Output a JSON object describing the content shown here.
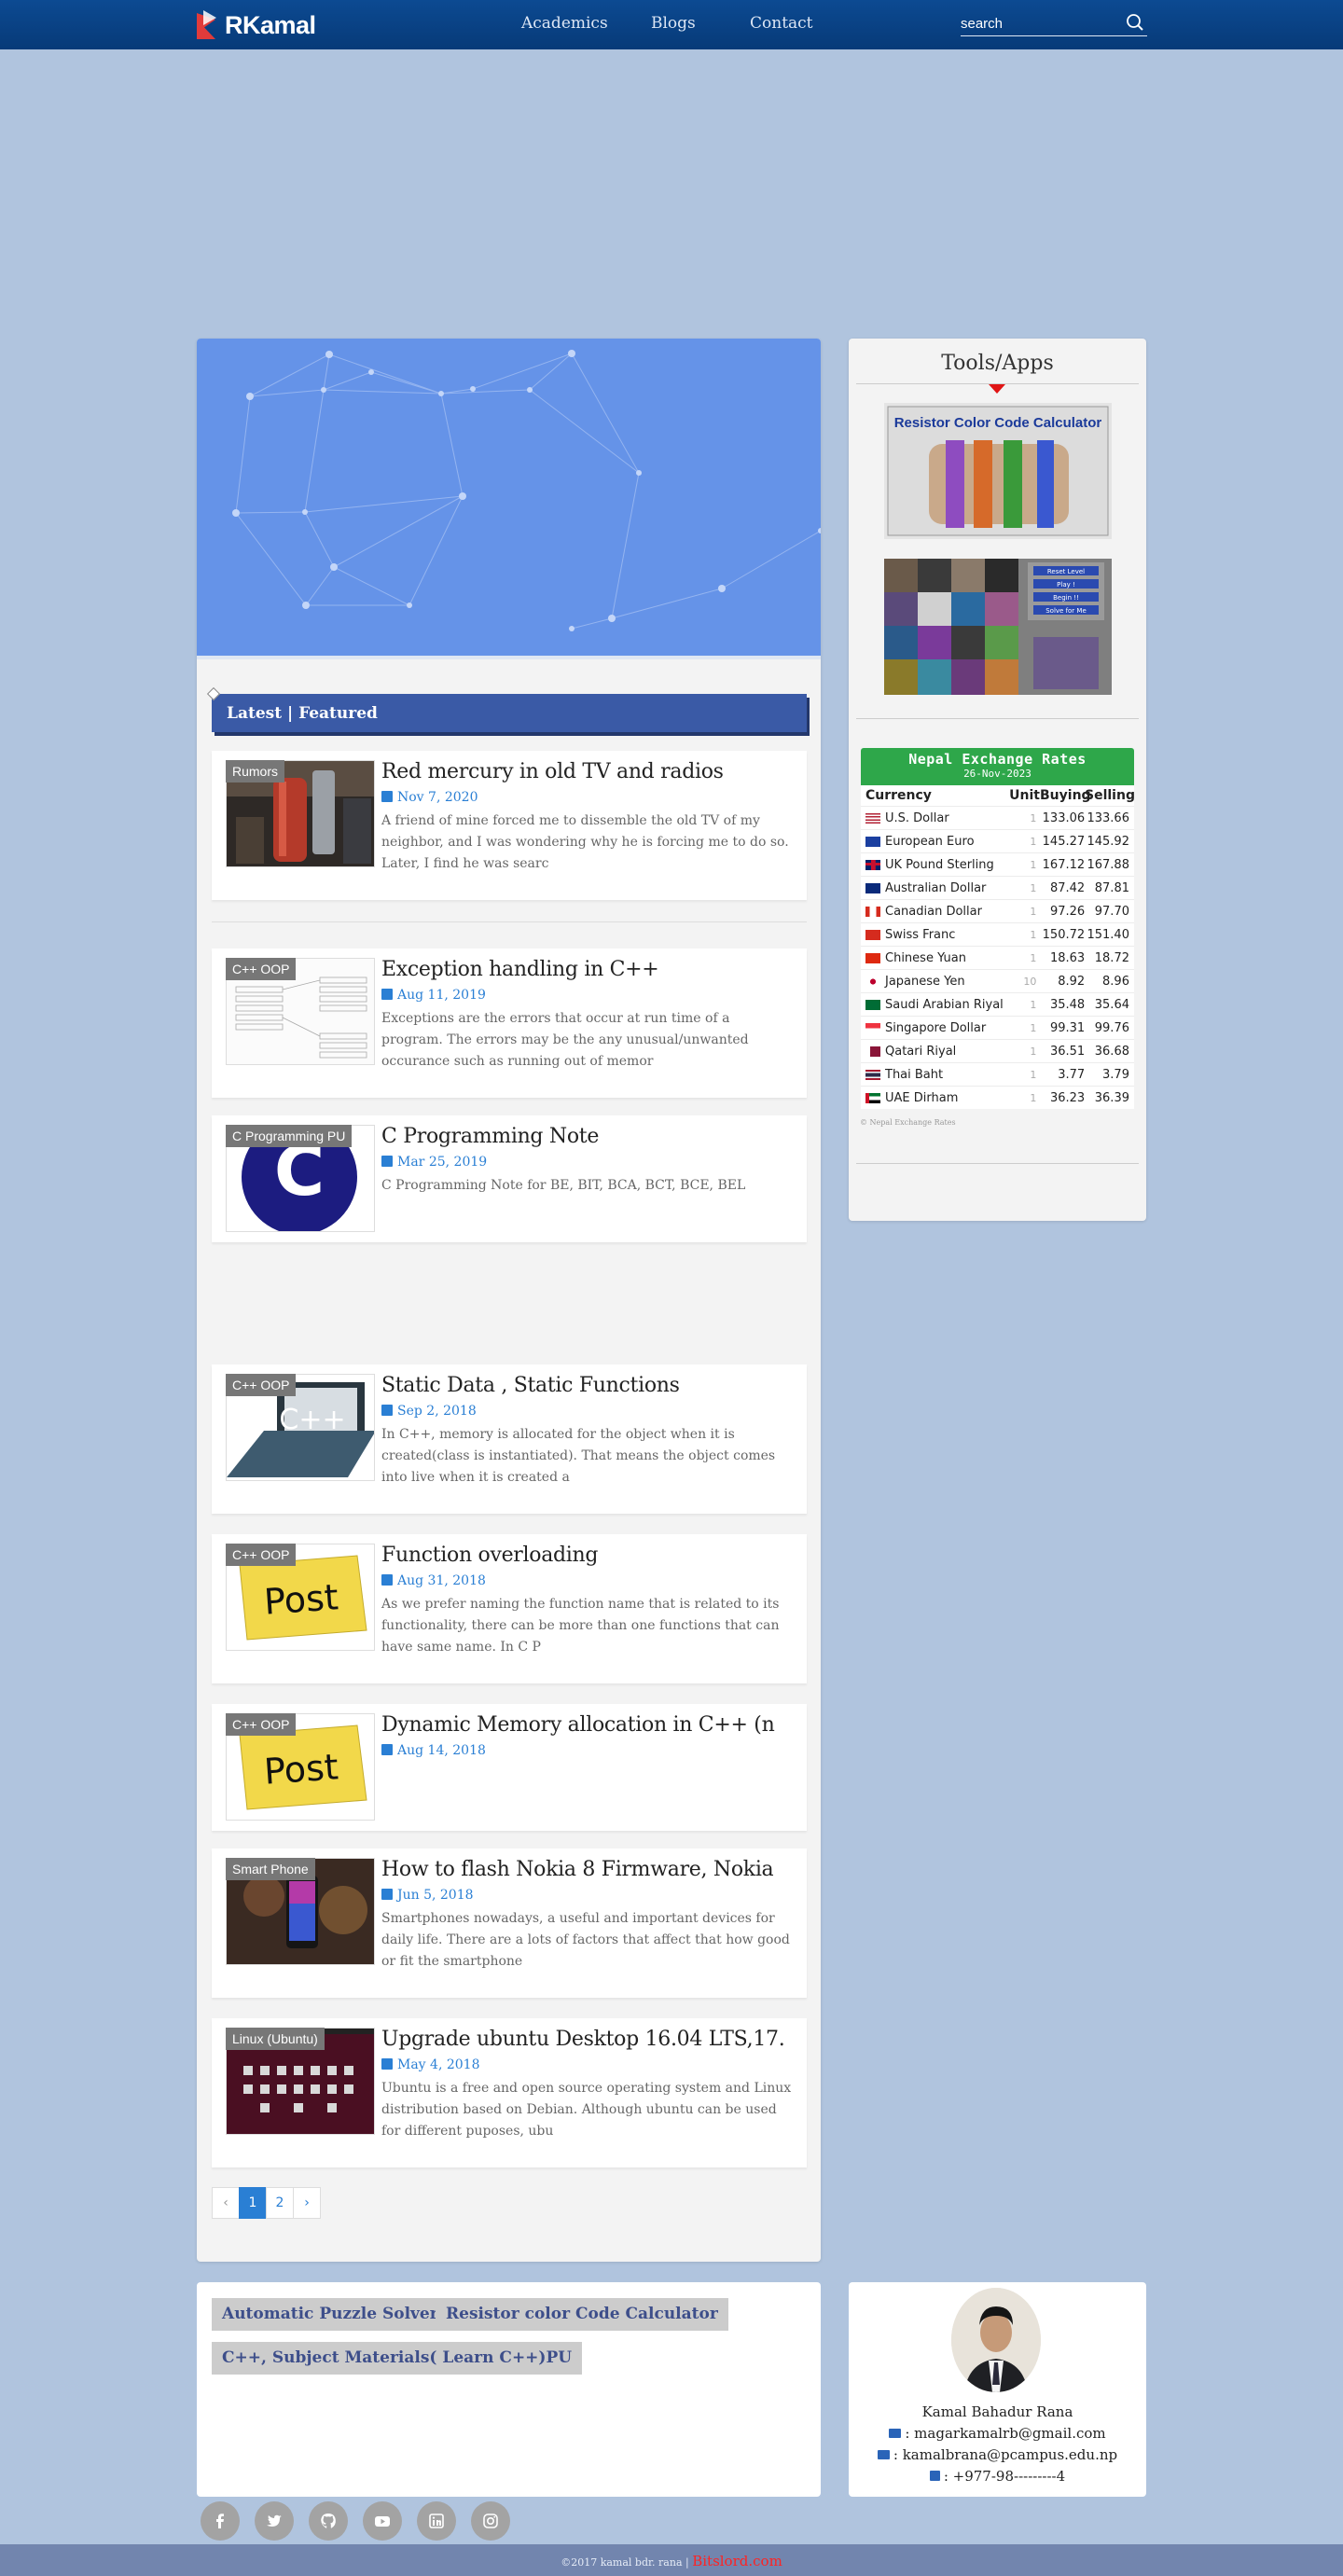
{
  "nav": {
    "brand": "RKamal",
    "links": [
      "Academics",
      "Blogs",
      "Contact"
    ],
    "search_placeholder": "search"
  },
  "featured": {
    "heading": "Latest | Featured",
    "posts": [
      {
        "badge": "Rumors",
        "title": "Red mercury in old TV and radios",
        "date": "Nov 7, 2020",
        "excerpt": "A friend of mine forced me to dissemble the old TV of my neighbor, and I was wondering why he is forcing me to do so. Later, I find he was searc"
      },
      {
        "badge": "C++ OOP",
        "title": "Exception handling in C++",
        "date": "Aug 11, 2019",
        "excerpt": "Exceptions are the errors that occur at run time of a program. The errors may be the any unusual/unwanted occurance such as running out of memor"
      },
      {
        "badge": "C Programming PU",
        "title": "C Programming Note",
        "date": "Mar 25, 2019",
        "excerpt": "C Programming Note for BE, BIT, BCA, BCT, BCE, BEL"
      },
      {
        "badge": "C++ OOP",
        "title": "Static Data , Static Functions",
        "date": "Sep 2, 2018",
        "excerpt": "In C++, memory is allocated for the object when it is created(class is instantiated). That means the object comes into live when it is created a"
      },
      {
        "badge": "C++ OOP",
        "title": "Function overloading",
        "date": "Aug 31, 2018",
        "excerpt": "As we prefer naming the function name that is related to its functionality, there can be more than one functions that can have same name. In C P"
      },
      {
        "badge": "C++ OOP",
        "title": "Dynamic Memory allocation in C++ (n",
        "date": "Aug 14, 2018",
        "excerpt": ""
      },
      {
        "badge": "Smart Phone",
        "title": "How to flash Nokia 8 Firmware, Nokia",
        "date": "Jun 5, 2018",
        "excerpt": "Smartphones nowadays, a useful and important devices for daily life. There are a lots of factors that affect that how good or fit the smartphone"
      },
      {
        "badge": "Linux (Ubuntu)",
        "title": "Upgrade ubuntu Desktop 16.04 LTS,17.",
        "date": "May 4, 2018",
        "excerpt": "Ubuntu is a free and open source operating system and Linux distribution based on Debian. Although ubuntu can be used for different puposes, ubu"
      }
    ],
    "thumb_text": {
      "post_word": "Post",
      "c_letter": "C",
      "cpp": "C++"
    },
    "pager": {
      "prev": "‹",
      "pages": [
        "1",
        "2"
      ],
      "next": "›",
      "current": "1"
    }
  },
  "sidebar": {
    "title": "Tools/Apps",
    "resistor_caption": "Resistor Color Code Calculator",
    "puzzle_buttons": [
      "Reset Level",
      "Play !",
      "Begin !!",
      "Solve for Me"
    ],
    "fx": {
      "title": "Nepal Exchange Rates",
      "date": "26-Nov-2023",
      "headers": {
        "currency": "Currency",
        "unit": "Unit",
        "buying": "Buying",
        "selling": "Selling"
      },
      "rows": [
        {
          "flag": "us",
          "name": "U.S. Dollar",
          "unit": "1",
          "buy": "133.06",
          "sell": "133.66"
        },
        {
          "flag": "eu",
          "name": "European Euro",
          "unit": "1",
          "buy": "145.27",
          "sell": "145.92"
        },
        {
          "flag": "uk",
          "name": "UK Pound Sterling",
          "unit": "1",
          "buy": "167.12",
          "sell": "167.88"
        },
        {
          "flag": "au",
          "name": "Australian Dollar",
          "unit": "1",
          "buy": "87.42",
          "sell": "87.81"
        },
        {
          "flag": "ca",
          "name": "Canadian Dollar",
          "unit": "1",
          "buy": "97.26",
          "sell": "97.70"
        },
        {
          "flag": "ch",
          "name": "Swiss Franc",
          "unit": "1",
          "buy": "150.72",
          "sell": "151.40"
        },
        {
          "flag": "cn",
          "name": "Chinese Yuan",
          "unit": "1",
          "buy": "18.63",
          "sell": "18.72"
        },
        {
          "flag": "jp",
          "name": "Japanese Yen",
          "unit": "10",
          "buy": "8.92",
          "sell": "8.96"
        },
        {
          "flag": "sa",
          "name": "Saudi Arabian Riyal",
          "unit": "1",
          "buy": "35.48",
          "sell": "35.64"
        },
        {
          "flag": "sg",
          "name": "Singapore Dollar",
          "unit": "1",
          "buy": "99.31",
          "sell": "99.76"
        },
        {
          "flag": "qa",
          "name": "Qatari Riyal",
          "unit": "1",
          "buy": "36.51",
          "sell": "36.68"
        },
        {
          "flag": "th",
          "name": "Thai Baht",
          "unit": "1",
          "buy": "3.77",
          "sell": "3.79"
        },
        {
          "flag": "ae",
          "name": "UAE Dirham",
          "unit": "1",
          "buy": "36.23",
          "sell": "36.39"
        }
      ],
      "footnote": "© Nepal Exchange Rates"
    }
  },
  "tags": [
    "Automatic Puzzle Solver",
    "Resistor color Code Calculator",
    "C++, Subject Materials( Learn C++)PU"
  ],
  "profile": {
    "name": "Kamal Bahadur Rana",
    "email1": ": magarkamalrb@gmail.com",
    "email2": ": kamalbrana@pcampus.edu.np",
    "phone": ": +977-98---------4"
  },
  "social_icons": [
    "facebook-icon",
    "twitter-icon",
    "github-icon",
    "youtube-icon",
    "linkedin-icon",
    "instagram-icon"
  ],
  "footer": {
    "copyright": "©2017 kamal bdr. rana |",
    "brand": "Bitslord.com"
  },
  "colors": {
    "navbar": "#0c4a92",
    "page_bg": "#b0c4de",
    "accent_blue": "#2a7fd4",
    "fx_green": "#2ea74a",
    "brand_red": "#ff2222"
  }
}
